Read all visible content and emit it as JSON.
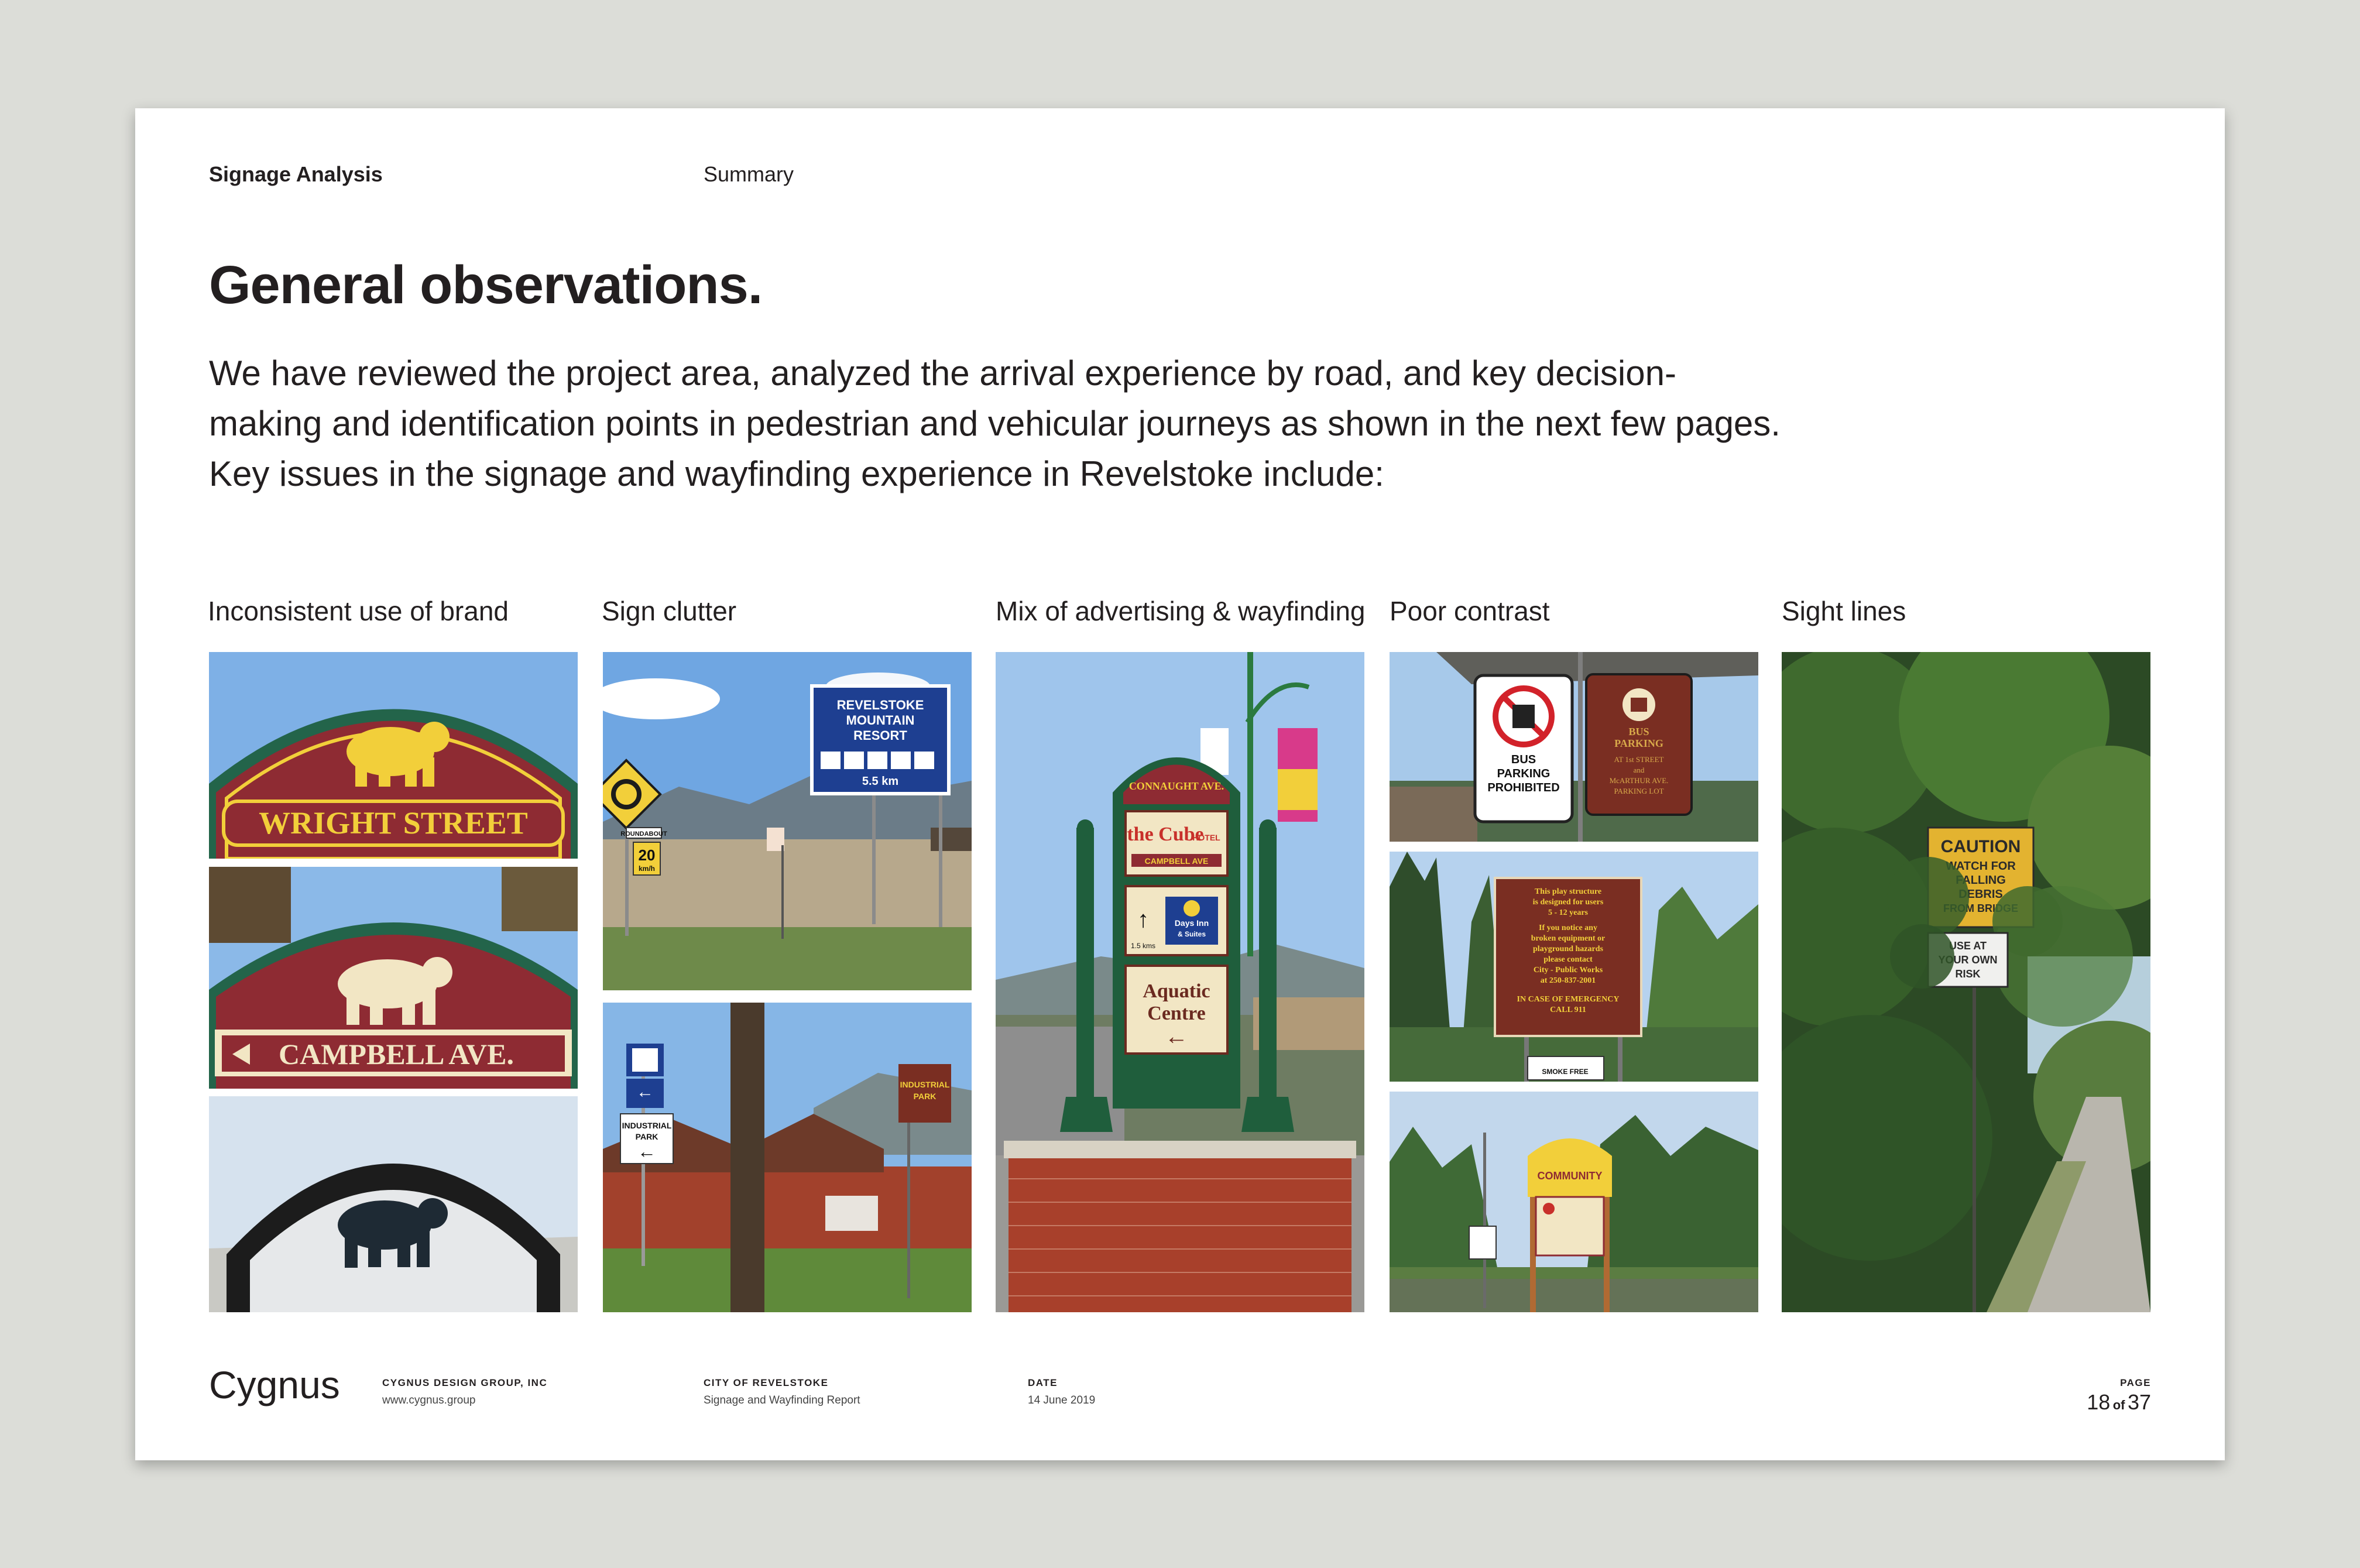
{
  "header": {
    "section": "Signage Analysis",
    "subsection": "Summary"
  },
  "title": "General observations.",
  "intro": "We have reviewed the project area, analyzed the arrival experience by road, and key decision-making and identification points in pedestrian and vehicular journeys as shown in the next few pages. Key issues in the signage and wayfinding experience in Revelstoke include:",
  "columns": [
    {
      "label": "Inconsistent use of brand"
    },
    {
      "label": "Sign clutter"
    },
    {
      "label": "Mix of advertising & wayfinding"
    },
    {
      "label": "Poor contrast"
    },
    {
      "label": "Sight lines"
    }
  ],
  "photos": {
    "wright": "WRIGHT STREET",
    "campbell": "CAMPBELL AVE.",
    "revelstoke_lines": [
      "REVELSTOKE",
      "MOUNTAIN",
      "RESORT"
    ],
    "revelstoke_dist": "5.5 km",
    "speed": "20",
    "speed_unit": "km/h",
    "roundabout": "ROUNDABOUT",
    "industrial": [
      "INDUSTRIAL",
      "PARK"
    ],
    "industrial_small": [
      "INDUSTRIAL",
      "PARK"
    ],
    "connaught": "CONNAUGHT AVE.",
    "cube": "the Cube",
    "cube_hotel": "HOTEL",
    "cube_street": "CAMPBELL AVE",
    "days_inn": [
      "Days Inn",
      "& Suites"
    ],
    "days_dist": "1.5 kms",
    "aquatic": [
      "Aquatic",
      "Centre"
    ],
    "bus_prohibited": [
      "BUS",
      "PARKING",
      "PROHIBITED"
    ],
    "bus_parking": [
      "BUS",
      "PARKING",
      "AT 1st STREET",
      "and",
      "McARTHUR AVE.",
      "PARKING LOT"
    ],
    "play": [
      "This play structure",
      "is designed for users",
      "5 - 12 years",
      "If you notice any",
      "broken equipment or",
      "playground hazards",
      "please contact",
      "City - Public Works",
      "at 250-837-2001",
      "IN CASE OF EMERGENCY",
      "CALL 911"
    ],
    "smoke": "SMOKE FREE",
    "community": "COMMUNITY",
    "caution": [
      "CAUTION",
      "WATCH FOR",
      "FALLING",
      "DEBRIS",
      "FROM BRIDGE"
    ],
    "own_risk": [
      "USE AT",
      "YOUR OWN",
      "RISK"
    ]
  },
  "footer": {
    "logo": "Cygnus",
    "company": "CYGNUS DESIGN GROUP, INC",
    "website": "www.cygnus.group",
    "client_label": "CITY OF REVELSTOKE",
    "client_value": "Signage and Wayfinding Report",
    "date_label": "DATE",
    "date_value": "14 June 2019",
    "page_label": "PAGE",
    "page_current": "18",
    "page_of": "of",
    "page_total": "37"
  },
  "colors": {
    "maroon": "#8e2b33",
    "green": "#23644a",
    "cream": "#f2e6c4",
    "yellow": "#f2cf3a",
    "blue": "#1e3f91",
    "sky": "#9fc5ec"
  }
}
